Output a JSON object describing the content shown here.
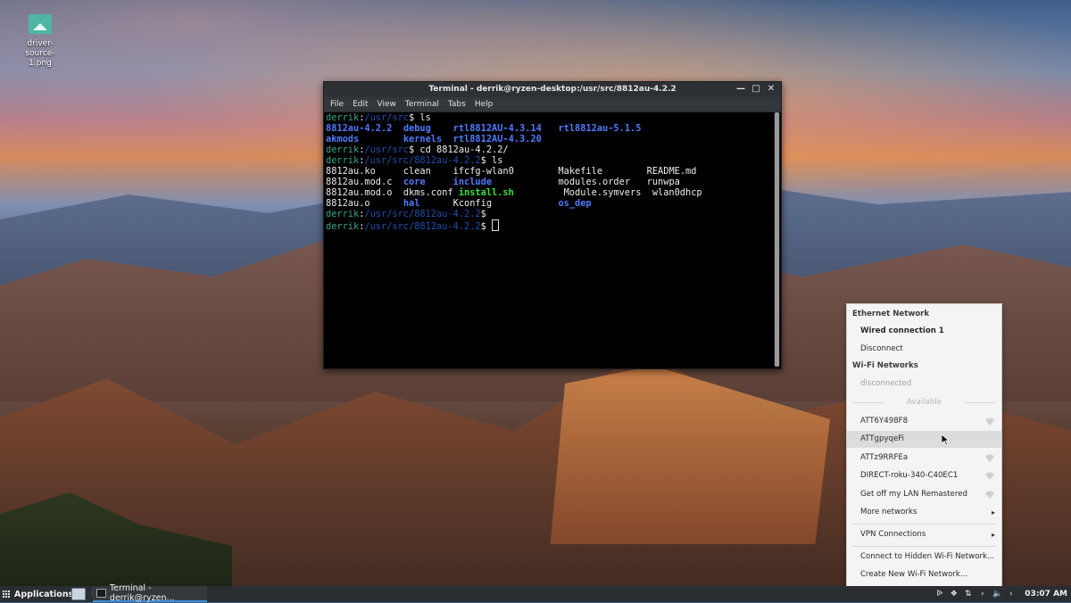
{
  "desktop": {
    "icon_label": "driver-source-1.png",
    "icon_label_line1": "driver-source-",
    "icon_label_line2": "1.png"
  },
  "terminal": {
    "title": "Terminal - derrik@ryzen-desktop:/usr/src/8812au-4.2.2",
    "menu": [
      "File",
      "Edit",
      "View",
      "Terminal",
      "Tabs",
      "Help"
    ],
    "lines": [
      {
        "user": "derrik",
        "path": "/usr/src",
        "cmd": "ls"
      },
      {
        "out": [
          [
            "8812au-4.2.2",
            "dir"
          ],
          [
            "debug",
            "dir"
          ],
          [
            "rtl8812AU-4.3.14",
            "dir"
          ],
          [
            "rtl8812au-5.1.5",
            "dir"
          ]
        ]
      },
      {
        "out": [
          [
            "akmods",
            "dir"
          ],
          [
            "kernels",
            "dir"
          ],
          [
            "rtl8812AU-4.3.20",
            "dir"
          ]
        ]
      },
      {
        "user": "derrik",
        "path": "/usr/src",
        "cmd": "cd 8812au-4.2.2/"
      },
      {
        "user": "derrik",
        "path": "/usr/src/8812au-4.2.2",
        "cmd": "ls"
      },
      {
        "out": [
          [
            "8812au.ko",
            ""
          ],
          [
            "clean",
            ""
          ],
          [
            "ifcfg-wlan0",
            ""
          ],
          [
            "Makefile",
            ""
          ],
          [
            "README.md",
            ""
          ]
        ]
      },
      {
        "out": [
          [
            "8812au.mod.c",
            ""
          ],
          [
            "core",
            "dir"
          ],
          [
            "include",
            "dir"
          ],
          [
            "modules.order",
            ""
          ],
          [
            "runwpa",
            ""
          ]
        ]
      },
      {
        "out": [
          [
            "8812au.mod.o",
            ""
          ],
          [
            "dkms.conf",
            ""
          ],
          [
            "install.sh",
            "exe"
          ],
          [
            "Module.symvers",
            ""
          ],
          [
            "wlan0dhcp",
            ""
          ]
        ]
      },
      {
        "out": [
          [
            "8812au.o",
            ""
          ],
          [
            "hal",
            "dir"
          ],
          [
            "Kconfig",
            ""
          ],
          [
            "os_dep",
            "dir"
          ]
        ]
      },
      {
        "user": "derrik",
        "path": "/usr/src/8812au-4.2.2",
        "cmd": ""
      },
      {
        "user": "derrik",
        "path": "/usr/src/8812au-4.2.2",
        "cmd": "",
        "cursor": true
      }
    ]
  },
  "network_menu": {
    "ethernet_header": "Ethernet Network",
    "wired_connection": "Wired connection 1",
    "disconnect": "Disconnect",
    "wifi_header": "Wi-Fi Networks",
    "wifi_status": "disconnected",
    "available": "Available",
    "networks": [
      "ATT6Y498F8",
      "ATTgpyqeFi",
      "ATTz9RRFEa",
      "DIRECT-roku-340-C40EC1",
      "Get off my LAN Remastered"
    ],
    "more_networks": "More networks",
    "vpn": "VPN Connections",
    "hidden": "Connect to Hidden Wi-Fi Network...",
    "create": "Create New Wi-Fi Network..."
  },
  "taskbar": {
    "applications": "Applications",
    "task_label": "Terminal - derrik@ryzen...",
    "clock": "03:07 AM"
  },
  "colors": {
    "prompt_user": "#2fa88a",
    "prompt_path": "#1e50b0",
    "dir": "#4f7bff",
    "exe": "#35e635",
    "taskbar": "#2a2e32",
    "accent": "#3d8bd6"
  }
}
